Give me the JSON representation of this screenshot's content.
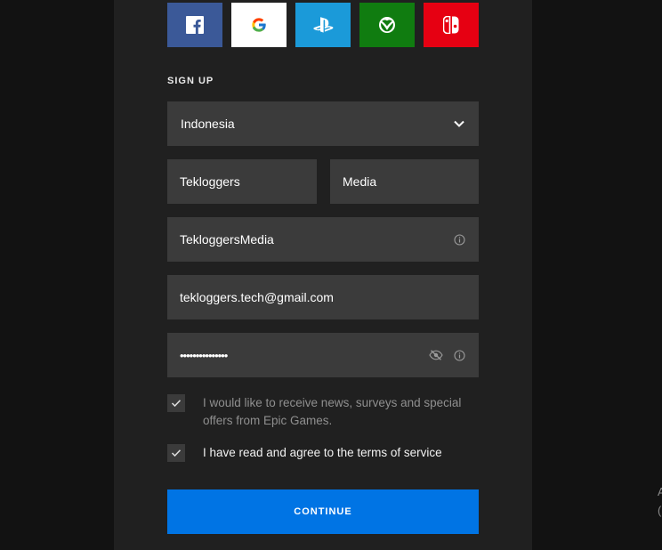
{
  "social": [
    {
      "name": "facebook",
      "icon": "facebook-icon",
      "color": "#3b5998"
    },
    {
      "name": "google",
      "icon": "google-icon",
      "color": "#ffffff"
    },
    {
      "name": "playstation",
      "icon": "playstation-icon",
      "color": "#1b9ad9"
    },
    {
      "name": "xbox",
      "icon": "xbox-icon",
      "color": "#107c10"
    },
    {
      "name": "nintendo",
      "icon": "nintendo-switch-icon",
      "color": "#e60012"
    }
  ],
  "signup": {
    "heading": "SIGN UP",
    "country": "Indonesia",
    "first_name": "Tekloggers",
    "last_name": "Media",
    "display_name": "TekloggersMedia",
    "email": "tekloggers.tech@gmail.com",
    "password_mask": "•••••••••••••••",
    "news_opt_in": {
      "checked": true,
      "text": "I would like to receive news, surveys and special offers from Epic Games."
    },
    "tos": {
      "checked": true,
      "text_prefix": "I have read and agree to the",
      "link_text": "terms of service"
    },
    "continue_label": "CONTINUE"
  },
  "edge_glyphs": {
    "top": "A",
    "bottom": "("
  },
  "colors": {
    "accent": "#0074e4",
    "panel": "#202020",
    "field": "#3b3b3b",
    "background": "#121212"
  }
}
